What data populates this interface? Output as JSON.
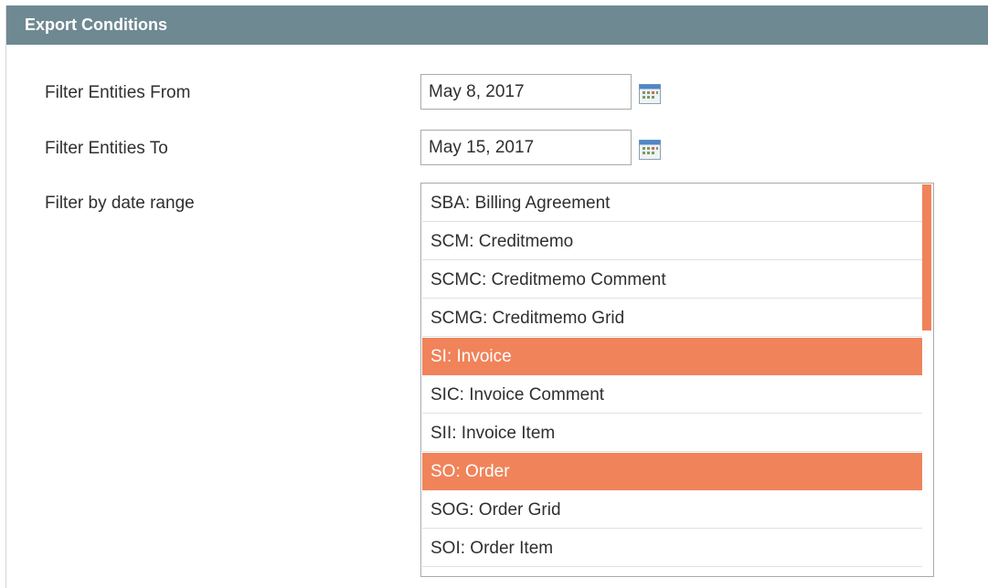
{
  "panel": {
    "title": "Export Conditions"
  },
  "filters": {
    "from_label": "Filter Entities From",
    "from_value": "May 8, 2017",
    "to_label": "Filter Entities To",
    "to_value": "May 15, 2017",
    "range_label": "Filter by date range"
  },
  "entities": [
    {
      "label": "SBA: Billing Agreement",
      "selected": false
    },
    {
      "label": "SCM: Creditmemo",
      "selected": false
    },
    {
      "label": "SCMC: Creditmemo Comment",
      "selected": false
    },
    {
      "label": "SCMG: Creditmemo Grid",
      "selected": false
    },
    {
      "label": "SI: Invoice",
      "selected": true
    },
    {
      "label": "SIC: Invoice Comment",
      "selected": false
    },
    {
      "label": "SII: Invoice Item",
      "selected": false
    },
    {
      "label": "SO: Order",
      "selected": true
    },
    {
      "label": "SOG: Order Grid",
      "selected": false
    },
    {
      "label": "SOI: Order Item",
      "selected": false
    }
  ],
  "colors": {
    "header_bg": "#6f8992",
    "selection": "#f0835a"
  },
  "icons": {
    "calendar": "calendar-icon"
  }
}
